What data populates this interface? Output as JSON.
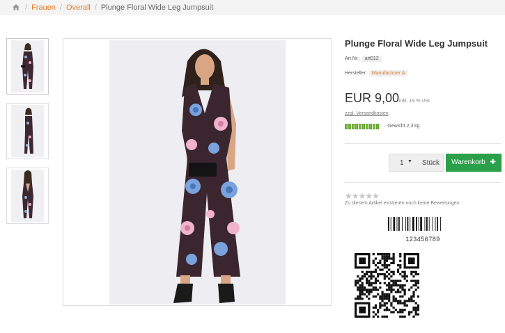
{
  "breadcrumb": {
    "home_icon": "home-icon",
    "items": [
      "Frauen",
      "Overall"
    ],
    "current": "Plunge Floral Wide Leg Jumpsuit",
    "separator": "/"
  },
  "product": {
    "title": "Plunge Floral Wide Leg Jumpsuit",
    "art_label": "Art.Nr.:",
    "art_value": "art012",
    "maker_label": "Hersteller:",
    "maker_value": "Manufacturer A",
    "price": "EUR 9,00",
    "tax_note": "inkl. 19 % USt",
    "shipping_link": "zzgl. Versandkosten",
    "weight": "· Gewicht 2,3 kg",
    "stock_level": 1.0
  },
  "cart": {
    "quantity": "1",
    "unit": "Stück",
    "button_label": "Warenkorb",
    "button_icon": "plus-icon"
  },
  "reviews": {
    "stars": "★★★★★",
    "rating": 0,
    "text": "Zu diesem Artikel existieren noch keine Bewertungen"
  },
  "barcode": {
    "ean": "123456789"
  },
  "colors": {
    "accent": "#e07a2a",
    "cart_green": "#2aa04a",
    "stock_green": "#7fbf3f"
  }
}
